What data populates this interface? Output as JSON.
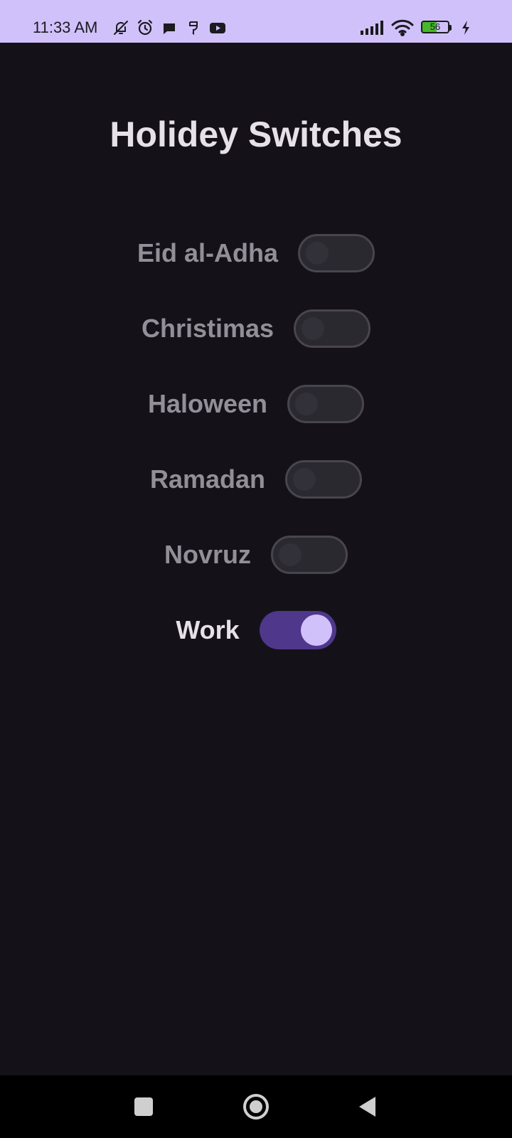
{
  "status_bar": {
    "time": "11:33 AM",
    "battery_level": "56",
    "left_icons": [
      "bell-off-icon",
      "alarm-icon",
      "chat-bubble-icon",
      "hangouts-icon",
      "youtube-icon"
    ],
    "right_icons": [
      "signal-icon",
      "wifi-icon",
      "battery-icon",
      "charging-bolt-icon"
    ],
    "background": "#d1c1fb"
  },
  "app": {
    "title": "Holidey Switches",
    "background": "#141218",
    "accent": "#4f378b",
    "thumb_on": "#d1c1fb"
  },
  "switches": [
    {
      "label": "Eid al-Adha",
      "on": false
    },
    {
      "label": "Christimas",
      "on": false
    },
    {
      "label": "Haloween",
      "on": false
    },
    {
      "label": "Ramadan",
      "on": false
    },
    {
      "label": "Novruz",
      "on": false
    },
    {
      "label": "Work",
      "on": true
    }
  ],
  "nav_bar": {
    "buttons": [
      "recents-square-icon",
      "home-circle-icon",
      "back-triangle-icon"
    ]
  }
}
